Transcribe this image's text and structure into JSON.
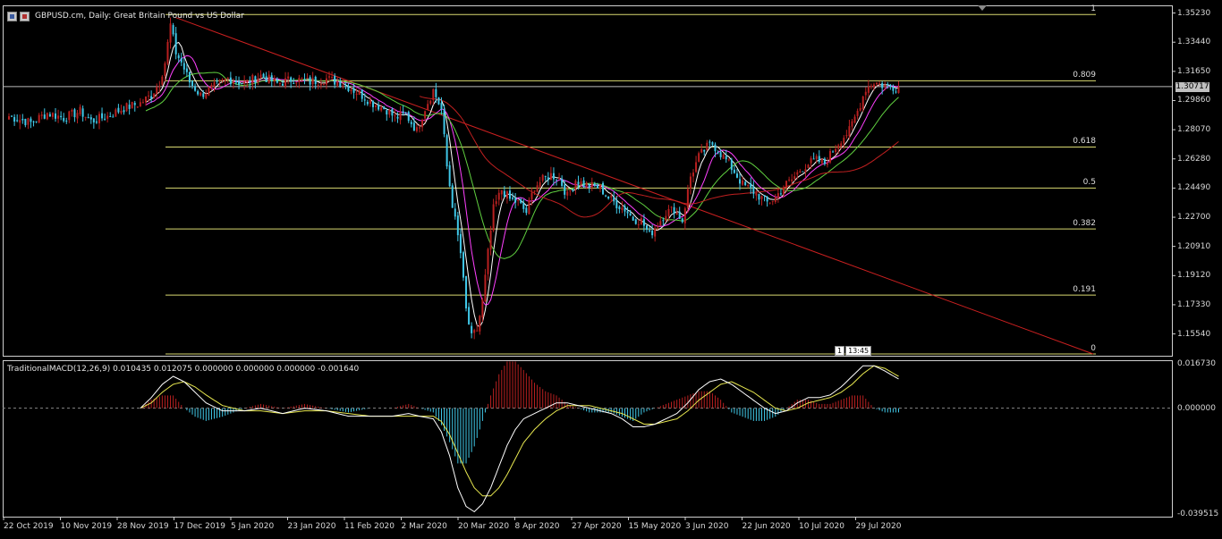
{
  "window": {
    "title": "GBPUSD.cm, Daily:  Great Britain Pound vs US Dollar"
  },
  "price_axis_labels": [
    "1.35230",
    "1.33440",
    "1.31650",
    "1.29860",
    "1.28070",
    "1.26280",
    "1.24490",
    "1.22700",
    "1.20910",
    "1.19120",
    "1.17330",
    "1.15540"
  ],
  "current_price": "1.30717",
  "macd": {
    "title": "TraditionalMACD(12,26,9) 0.010435 0.012075 0.000000 0.000000 0.000000 -0.001640",
    "axis_labels": [
      "0.016730",
      "0.000000",
      "-0.039515"
    ]
  },
  "date_labels": [
    "22 Oct 2019",
    "10 Nov 2019",
    "28 Nov 2019",
    "17 Dec 2019",
    "5 Jan 2020",
    "23 Jan 2020",
    "11 Feb 2020",
    "2 Mar 2020",
    "20 Mar 2020",
    "8 Apr 2020",
    "27 Apr 2020",
    "15 May 2020",
    "3 Jun 2020",
    "22 Jun 2020",
    "10 Jul 2020",
    "29 Jul 2020"
  ],
  "timer": {
    "left": "1",
    "right": "13:45"
  },
  "colors": {
    "bull": "#b82020",
    "bear": "#40c8e8",
    "fib": "#d8d870",
    "trend": "#cc2020",
    "ma_fast": "#ffffff",
    "ma_mid": "#ff40ff",
    "ma_slow": "#60d040",
    "ma_long": "#c02020",
    "macd_line": "#ffffff",
    "signal_line": "#e8e850",
    "grid": "#cfcfcf"
  },
  "chart_data": [
    {
      "type": "candlestick",
      "title": "GBPUSD.cm, Daily:  Great Britain Pound vs US Dollar",
      "ylim": [
        1.142,
        1.357
      ],
      "x_ticks": [
        "22 Oct 2019",
        "10 Nov 2019",
        "28 Nov 2019",
        "17 Dec 2019",
        "5 Jan 2020",
        "23 Jan 2020",
        "11 Feb 2020",
        "2 Mar 2020",
        "20 Mar 2020",
        "8 Apr 2020",
        "27 Apr 2020",
        "15 May 2020",
        "3 Jun 2020",
        "22 Jun 2020",
        "10 Jul 2020",
        "29 Jul 2020"
      ],
      "y_ticks": [
        1.3523,
        1.3344,
        1.3165,
        1.2986,
        1.2807,
        1.2628,
        1.2449,
        1.227,
        1.2091,
        1.1912,
        1.1733,
        1.1554
      ],
      "current_price": 1.30717,
      "close_path": [
        [
          0,
          1.289
        ],
        [
          8,
          1.285
        ],
        [
          14,
          1.291
        ],
        [
          20,
          1.288
        ],
        [
          26,
          1.292
        ],
        [
          30,
          1.286
        ],
        [
          36,
          1.289
        ],
        [
          42,
          1.294
        ],
        [
          48,
          1.297
        ],
        [
          52,
          1.302
        ],
        [
          55,
          1.31
        ],
        [
          57,
          1.322
        ],
        [
          59,
          1.345
        ],
        [
          61,
          1.328
        ],
        [
          63,
          1.322
        ],
        [
          66,
          1.31
        ],
        [
          70,
          1.302
        ],
        [
          74,
          1.306
        ],
        [
          80,
          1.312
        ],
        [
          86,
          1.309
        ],
        [
          92,
          1.314
        ],
        [
          98,
          1.309
        ],
        [
          104,
          1.312
        ],
        [
          110,
          1.31
        ],
        [
          116,
          1.312
        ],
        [
          122,
          1.309
        ],
        [
          128,
          1.303
        ],
        [
          133,
          1.297
        ],
        [
          138,
          1.293
        ],
        [
          141,
          1.288
        ],
        [
          145,
          1.29
        ],
        [
          149,
          1.28
        ],
        [
          152,
          1.294
        ],
        [
          155,
          1.305
        ],
        [
          158,
          1.293
        ],
        [
          160,
          1.258
        ],
        [
          162,
          1.235
        ],
        [
          165,
          1.205
        ],
        [
          167,
          1.17
        ],
        [
          169,
          1.153
        ],
        [
          171,
          1.158
        ],
        [
          173,
          1.175
        ],
        [
          175,
          1.205
        ],
        [
          177,
          1.232
        ],
        [
          180,
          1.244
        ],
        [
          183,
          1.238
        ],
        [
          186,
          1.236
        ],
        [
          189,
          1.23
        ],
        [
          192,
          1.246
        ],
        [
          195,
          1.25
        ],
        [
          198,
          1.253
        ],
        [
          201,
          1.251
        ],
        [
          204,
          1.24
        ],
        [
          207,
          1.25
        ],
        [
          210,
          1.247
        ],
        [
          213,
          1.246
        ],
        [
          216,
          1.245
        ],
        [
          219,
          1.239
        ],
        [
          222,
          1.235
        ],
        [
          225,
          1.232
        ],
        [
          228,
          1.226
        ],
        [
          231,
          1.225
        ],
        [
          234,
          1.216
        ],
        [
          237,
          1.223
        ],
        [
          240,
          1.23
        ],
        [
          243,
          1.232
        ],
        [
          246,
          1.225
        ],
        [
          249,
          1.252
        ],
        [
          252,
          1.264
        ],
        [
          255,
          1.27
        ],
        [
          257,
          1.272
        ],
        [
          259,
          1.268
        ],
        [
          262,
          1.262
        ],
        [
          265,
          1.255
        ],
        [
          268,
          1.247
        ],
        [
          271,
          1.244
        ],
        [
          274,
          1.24
        ],
        [
          277,
          1.236
        ],
        [
          280,
          1.239
        ],
        [
          283,
          1.246
        ],
        [
          286,
          1.25
        ],
        [
          289,
          1.256
        ],
        [
          292,
          1.26
        ],
        [
          295,
          1.262
        ],
        [
          298,
          1.26
        ],
        [
          301,
          1.268
        ],
        [
          304,
          1.275
        ],
        [
          307,
          1.28
        ],
        [
          310,
          1.292
        ],
        [
          313,
          1.306
        ],
        [
          316,
          1.31
        ],
        [
          319,
          1.308
        ],
        [
          322,
          1.307
        ],
        [
          325,
          1.307
        ]
      ],
      "fibonacci": [
        {
          "level": "1",
          "price": 1.3514
        },
        {
          "level": "0.809",
          "price": 1.3107
        },
        {
          "level": "0.618",
          "price": 1.2701
        },
        {
          "level": "0.5",
          "price": 1.2449
        },
        {
          "level": "0.382",
          "price": 1.2198
        },
        {
          "level": "0.191",
          "price": 1.1792
        },
        {
          "level": "0",
          "price": 1.1385
        }
      ],
      "trendline": [
        [
          61,
          1.3495
        ],
        [
          365,
          1.1395
        ]
      ],
      "moving_averages": [
        {
          "color_key": "ma_fast",
          "period": "fast"
        },
        {
          "color_key": "ma_mid",
          "period": "mid"
        },
        {
          "color_key": "ma_slow",
          "period": "slow"
        },
        {
          "color_key": "ma_long",
          "period": "long"
        }
      ]
    },
    {
      "type": "macd",
      "title": "TraditionalMACD(12,26,9) 0.010435 0.012075 0.000000 0.000000 0.000000 -0.001640",
      "ylim": [
        -0.039515,
        0.01673
      ],
      "macd_path": [
        [
          48,
          0.0
        ],
        [
          52,
          0.004
        ],
        [
          56,
          0.009
        ],
        [
          60,
          0.012
        ],
        [
          64,
          0.01
        ],
        [
          68,
          0.006
        ],
        [
          72,
          0.002
        ],
        [
          78,
          -0.001
        ],
        [
          86,
          -0.001
        ],
        [
          92,
          0.0
        ],
        [
          100,
          -0.002
        ],
        [
          108,
          0.0
        ],
        [
          116,
          -0.001
        ],
        [
          124,
          -0.003
        ],
        [
          132,
          -0.003
        ],
        [
          140,
          -0.003
        ],
        [
          146,
          -0.002
        ],
        [
          150,
          -0.003
        ],
        [
          155,
          -0.004
        ],
        [
          158,
          -0.009
        ],
        [
          161,
          -0.018
        ],
        [
          164,
          -0.03
        ],
        [
          167,
          -0.037
        ],
        [
          170,
          -0.039
        ],
        [
          173,
          -0.036
        ],
        [
          176,
          -0.03
        ],
        [
          179,
          -0.022
        ],
        [
          182,
          -0.014
        ],
        [
          185,
          -0.008
        ],
        [
          188,
          -0.004
        ],
        [
          192,
          -0.002
        ],
        [
          196,
          0.0
        ],
        [
          200,
          0.002
        ],
        [
          204,
          0.002
        ],
        [
          208,
          0.001
        ],
        [
          212,
          0.0
        ],
        [
          216,
          -0.001
        ],
        [
          220,
          -0.002
        ],
        [
          224,
          -0.004
        ],
        [
          228,
          -0.007
        ],
        [
          232,
          -0.007
        ],
        [
          236,
          -0.006
        ],
        [
          240,
          -0.004
        ],
        [
          244,
          -0.002
        ],
        [
          248,
          0.002
        ],
        [
          252,
          0.007
        ],
        [
          256,
          0.01
        ],
        [
          260,
          0.011
        ],
        [
          264,
          0.009
        ],
        [
          268,
          0.006
        ],
        [
          272,
          0.003
        ],
        [
          276,
          0.0
        ],
        [
          280,
          -0.002
        ],
        [
          284,
          -0.001
        ],
        [
          288,
          0.002
        ],
        [
          292,
          0.004
        ],
        [
          296,
          0.004
        ],
        [
          300,
          0.005
        ],
        [
          304,
          0.008
        ],
        [
          308,
          0.012
        ],
        [
          312,
          0.016
        ],
        [
          316,
          0.016
        ],
        [
          320,
          0.014
        ],
        [
          325,
          0.011
        ]
      ],
      "signal_path": [
        [
          48,
          0.0
        ],
        [
          52,
          0.002
        ],
        [
          56,
          0.006
        ],
        [
          60,
          0.009
        ],
        [
          64,
          0.01
        ],
        [
          68,
          0.008
        ],
        [
          72,
          0.005
        ],
        [
          78,
          0.001
        ],
        [
          86,
          -0.001
        ],
        [
          92,
          -0.001
        ],
        [
          100,
          -0.002
        ],
        [
          108,
          -0.001
        ],
        [
          116,
          -0.001
        ],
        [
          124,
          -0.002
        ],
        [
          132,
          -0.003
        ],
        [
          140,
          -0.003
        ],
        [
          146,
          -0.003
        ],
        [
          150,
          -0.003
        ],
        [
          155,
          -0.003
        ],
        [
          158,
          -0.005
        ],
        [
          161,
          -0.01
        ],
        [
          164,
          -0.017
        ],
        [
          167,
          -0.024
        ],
        [
          170,
          -0.03
        ],
        [
          173,
          -0.033
        ],
        [
          176,
          -0.033
        ],
        [
          179,
          -0.03
        ],
        [
          182,
          -0.025
        ],
        [
          185,
          -0.019
        ],
        [
          188,
          -0.013
        ],
        [
          192,
          -0.008
        ],
        [
          196,
          -0.004
        ],
        [
          200,
          -0.001
        ],
        [
          204,
          0.001
        ],
        [
          208,
          0.001
        ],
        [
          212,
          0.001
        ],
        [
          216,
          0.0
        ],
        [
          220,
          -0.001
        ],
        [
          224,
          -0.002
        ],
        [
          228,
          -0.004
        ],
        [
          232,
          -0.006
        ],
        [
          236,
          -0.006
        ],
        [
          240,
          -0.005
        ],
        [
          244,
          -0.004
        ],
        [
          248,
          -0.001
        ],
        [
          252,
          0.003
        ],
        [
          256,
          0.006
        ],
        [
          260,
          0.009
        ],
        [
          264,
          0.01
        ],
        [
          268,
          0.008
        ],
        [
          272,
          0.006
        ],
        [
          276,
          0.003
        ],
        [
          280,
          0.0
        ],
        [
          284,
          -0.001
        ],
        [
          288,
          0.0
        ],
        [
          292,
          0.002
        ],
        [
          296,
          0.003
        ],
        [
          300,
          0.004
        ],
        [
          304,
          0.006
        ],
        [
          308,
          0.009
        ],
        [
          312,
          0.013
        ],
        [
          316,
          0.016
        ],
        [
          320,
          0.015
        ],
        [
          325,
          0.012
        ]
      ]
    }
  ]
}
